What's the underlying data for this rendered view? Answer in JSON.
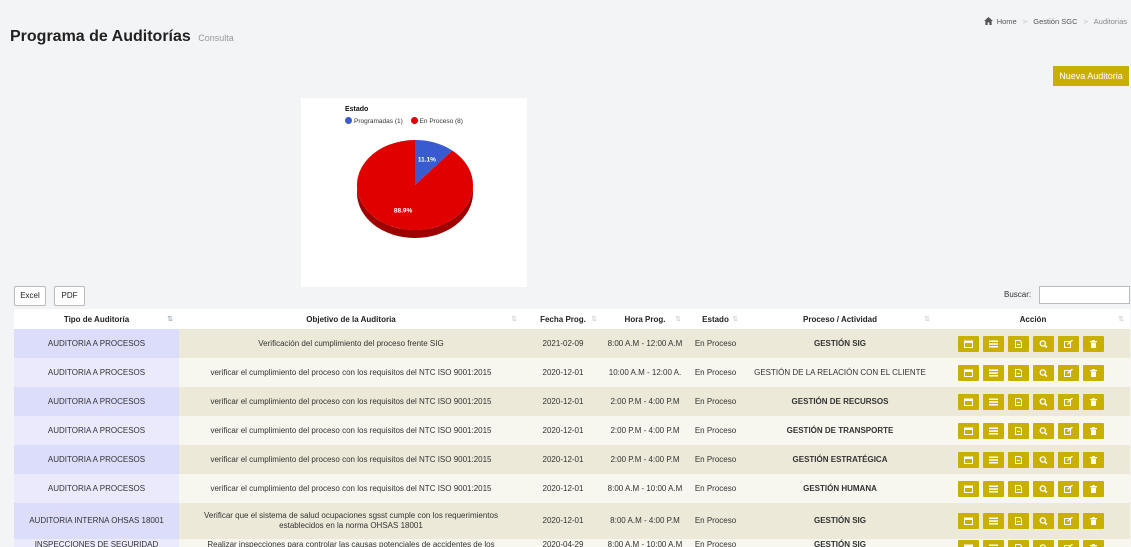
{
  "header": {
    "title": "Programa de Auditorías",
    "subtitle": "Consulta"
  },
  "breadcrumb": {
    "home": "Home",
    "section": "Gestión SGC",
    "current": "Auditorias"
  },
  "new_button": "Nueva Auditoria",
  "chart_data": {
    "type": "pie",
    "title": "Estado",
    "legend_labels": [
      "Programadas (1)",
      "En Proceso (8)"
    ],
    "categories": [
      "Programadas",
      "En Proceso"
    ],
    "values": [
      1,
      8
    ],
    "percent_labels": [
      "11.1%",
      "88.9%"
    ],
    "colors": [
      "#3a5bcf",
      "#e00000"
    ]
  },
  "toolbar": {
    "excel": "Excel",
    "pdf": "PDF",
    "search_label": "Buscar:"
  },
  "columns": [
    "Tipo de Auditoría",
    "Objetivo de la Auditoria",
    "Fecha Prog.",
    "Hora Prog.",
    "Estado",
    "Proceso / Actividad",
    "Acción"
  ],
  "sort_icon": "⇅",
  "rows": [
    {
      "tipo": "AUDITORIA A PROCESOS",
      "objetivo": "Verificación del cumplimiento del proceso frente SIG",
      "fecha": "2021-02-09",
      "hora": "8:00 A.M - 12:00 A.M",
      "estado": "En Proceso",
      "proceso": "GESTIÓN SIG"
    },
    {
      "tipo": "AUDITORIA A PROCESOS",
      "objetivo": "verificar el cumplimiento del proceso con los requisitos del NTC ISO 9001:2015",
      "fecha": "2020-12-01",
      "hora": "10:00 A.M - 12:00 A.",
      "estado": "En Proceso",
      "proceso": "GESTIÓN DE LA RELACIÓN CON EL CLIENTE"
    },
    {
      "tipo": "AUDITORIA A PROCESOS",
      "objetivo": "verificar el cumplimiento del proceso con los requisitos del NTC ISO 9001:2015",
      "fecha": "2020-12-01",
      "hora": "2:00 P.M - 4:00 P.M",
      "estado": "En Proceso",
      "proceso": "GESTIÓN DE RECURSOS"
    },
    {
      "tipo": "AUDITORIA A PROCESOS",
      "objetivo": "verificar el cumplimiento del proceso con los requisitos del NTC ISO 9001:2015",
      "fecha": "2020-12-01",
      "hora": "2:00 P.M - 4:00 P.M",
      "estado": "En Proceso",
      "proceso": "GESTIÓN DE TRANSPORTE"
    },
    {
      "tipo": "AUDITORIA A PROCESOS",
      "objetivo": "verificar el cumplimiento del proceso con los requisitos del NTC ISO 9001:2015",
      "fecha": "2020-12-01",
      "hora": "2:00 P.M - 4:00 P.M",
      "estado": "En Proceso",
      "proceso": "GESTIÓN ESTRATÉGICA"
    },
    {
      "tipo": "AUDITORIA A PROCESOS",
      "objetivo": "verificar el cumplimiento del proceso con los requisitos del NTC ISO 9001:2015",
      "fecha": "2020-12-01",
      "hora": "8:00 A.M - 10:00 A.M",
      "estado": "En Proceso",
      "proceso": "GESTIÓN HUMANA"
    },
    {
      "tipo": "AUDITORIA INTERNA OHSAS 18001",
      "objetivo": "Verificar que el sistema de salud ocupaciones sgsst cumple con los requerimientos establecidos en la norma OHSAS 18001",
      "fecha": "2020-12-01",
      "hora": "8:00 A.M - 4:00 P.M",
      "estado": "En Proceso",
      "proceso": "GESTIÓN SIG"
    },
    {
      "tipo": "INSPECCIONES DE SEGURIDAD",
      "objetivo": "Realizar inspecciones para controlar las causas potenciales de accidentes de los",
      "fecha": "2020-04-29",
      "hora": "8:00 A.M - 10:00 A.M",
      "estado": "En Proceso",
      "proceso": "GESTIÓN SIG"
    }
  ],
  "action_icons": [
    "calendar-icon",
    "list-icon",
    "document-icon",
    "search-icon",
    "edit-icon",
    "trash-icon"
  ]
}
